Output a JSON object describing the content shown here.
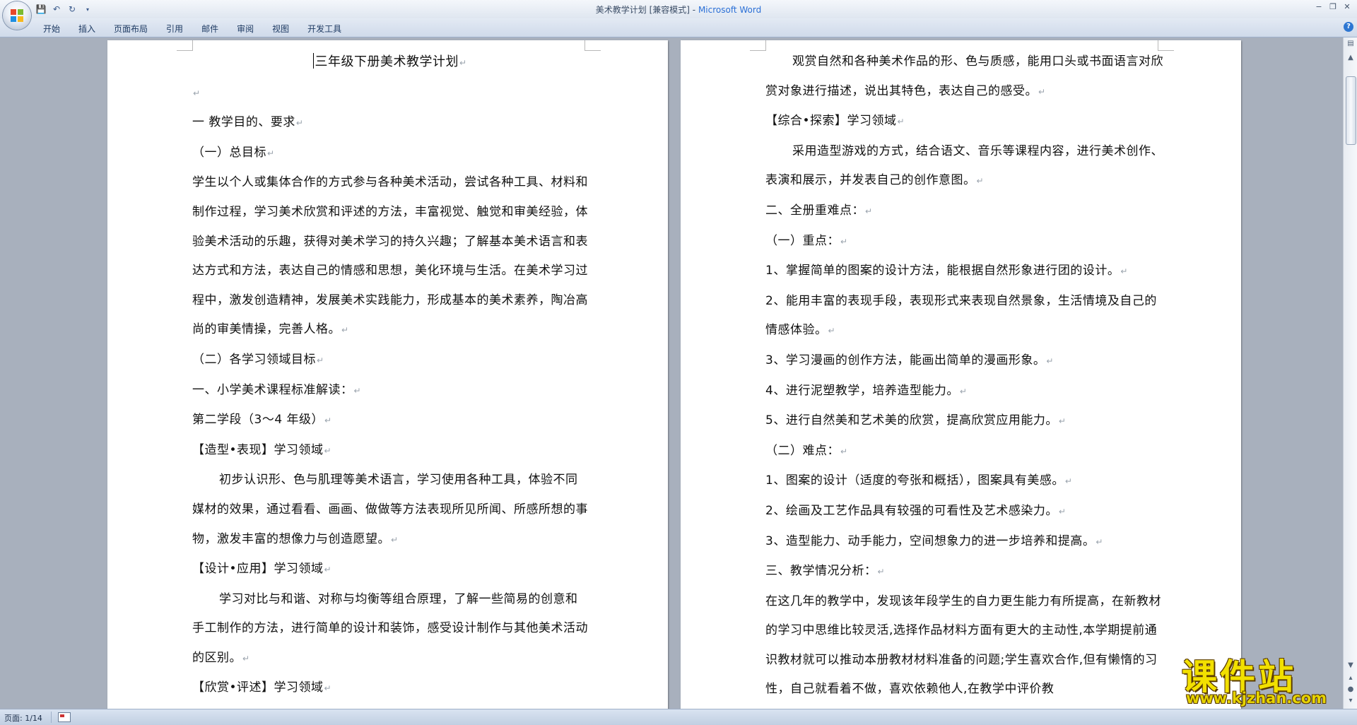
{
  "window": {
    "doc_title": "美术教学计划 [兼容模式]",
    "separator": " - ",
    "app_name": "Microsoft Word",
    "controls": [
      "−",
      "❐",
      "✕"
    ]
  },
  "ribbon": {
    "tabs": [
      "开始",
      "插入",
      "页面布局",
      "引用",
      "邮件",
      "审阅",
      "视图",
      "开发工具"
    ],
    "help": "?"
  },
  "quick_access": {
    "icons": [
      "save-icon",
      "undo-icon",
      "redo-icon",
      "customize-icon"
    ]
  },
  "pages": {
    "left": [
      {
        "text": "三年级下册美术教学计划",
        "style": "title",
        "cursor": true
      },
      {
        "text": "",
        "style": "plain"
      },
      {
        "text": "一  教学目的、要求",
        "style": "plain"
      },
      {
        "text": "（一）总目标",
        "style": "plain"
      },
      {
        "text": "学生以个人或集体合作的方式参与各种美术活动，尝试各种工具、材料和制作过程，学习美术欣赏和评述的方法，丰富视觉、触觉和审美经验，体验美术活动的乐趣，获得对美术学习的持久兴趣；了解基本美术语言和表达方式和方法，表达自己的情感和思想，美化环境与生活。在美术学习过程中，激发创造精神，发展美术实践能力，形成基本的美术素养，陶冶高尚的审美情操，完善人格。",
        "style": "plain"
      },
      {
        "text": "（二）各学习领域目标",
        "style": "plain"
      },
      {
        "text": "一、小学美术课程标准解读：",
        "style": "plain"
      },
      {
        "text": "第二学段（3～4 年级）",
        "style": "plain"
      },
      {
        "text": "【造型•表现】学习领域",
        "style": "plain"
      },
      {
        "text": "初步认识形、色与肌理等美术语言，学习使用各种工具，体验不同媒材的效果，通过看看、画画、做做等方法表现所见所闻、所感所想的事物，激发丰富的想像力与创造愿望。",
        "style": "indent"
      },
      {
        "text": "【设计•应用】学习领域",
        "style": "plain"
      },
      {
        "text": "学习对比与和谐、对称与均衡等组合原理，了解一些简易的创意和手工制作的方法，进行简单的设计和装饰，感受设计制作与其他美术活动的区别。",
        "style": "indent"
      },
      {
        "text": "【欣赏•评述】学习领域",
        "style": "plain"
      }
    ],
    "right": [
      {
        "text": "观赏自然和各种美术作品的形、色与质感，能用口头或书面语言对欣赏对象进行描述，说出其特色，表达自己的感受。",
        "style": "indent"
      },
      {
        "text": "【综合•探索】学习领域",
        "style": "plain"
      },
      {
        "text": "采用造型游戏的方式，结合语文、音乐等课程内容，进行美术创作、表演和展示，并发表自己的创作意图。",
        "style": "indent"
      },
      {
        "text": "二、全册重难点：",
        "style": "plain"
      },
      {
        "text": "（一）重点：",
        "style": "plain"
      },
      {
        "text": "1、掌握简单的图案的设计方法，能根据自然形象进行团的设计。",
        "style": "plain"
      },
      {
        "text": "2、能用丰富的表现手段，表现形式来表现自然景象，生活情境及自己的情感体验。",
        "style": "plain"
      },
      {
        "text": "3、学习漫画的创作方法，能画出简单的漫画形象。",
        "style": "plain"
      },
      {
        "text": "4、进行泥塑教学，培养造型能力。",
        "style": "plain"
      },
      {
        "text": "5、进行自然美和艺术美的欣赏，提高欣赏应用能力。",
        "style": "plain"
      },
      {
        "text": "（二）难点：",
        "style": "plain"
      },
      {
        "text": "1、图案的设计（适度的夸张和概括），图案具有美感。",
        "style": "plain"
      },
      {
        "text": "2、绘画及工艺作品具有较强的可看性及艺术感染力。",
        "style": "plain"
      },
      {
        "text": "3、造型能力、动手能力，空间想象力的进一步培养和提高。",
        "style": "plain"
      },
      {
        "text": "三、教学情况分析：",
        "style": "plain"
      },
      {
        "text": "在这几年的教学中，发现该年段学生的自力更生能力有所提高，在新教材的学习中思维比较灵活,选择作品材料方面有更大的主动性,本学期提前通识教材就可以推动本册教材材料准备的问题;学生喜欢合作,但有懒惰的习性，自己就看着不做，喜欢依赖他人,在教学中评价教",
        "style": "plain",
        "no_mark": true
      }
    ],
    "paragraph_mark": "↵"
  },
  "status": {
    "page_count": "页面: 1/14"
  },
  "watermark": {
    "name": "课件站",
    "url": "www.kjzhan.com"
  }
}
